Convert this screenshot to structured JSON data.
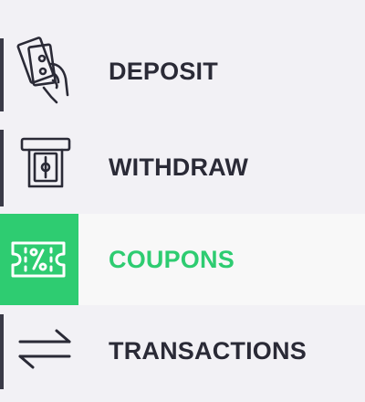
{
  "menu": {
    "items": [
      {
        "label": "DEPOSIT",
        "icon": "money-in-hand-icon",
        "active": false
      },
      {
        "label": "WITHDRAW",
        "icon": "atm-withdraw-icon",
        "active": false
      },
      {
        "label": "COUPONS",
        "icon": "coupon-ticket-icon",
        "active": true
      },
      {
        "label": "TRANSACTIONS",
        "icon": "transfer-arrows-icon",
        "active": false
      }
    ]
  },
  "colors": {
    "background": "#f2f1f5",
    "active_accent": "#2ecc71",
    "text": "#2a2a36",
    "icon_stroke": "#2a2a36"
  }
}
